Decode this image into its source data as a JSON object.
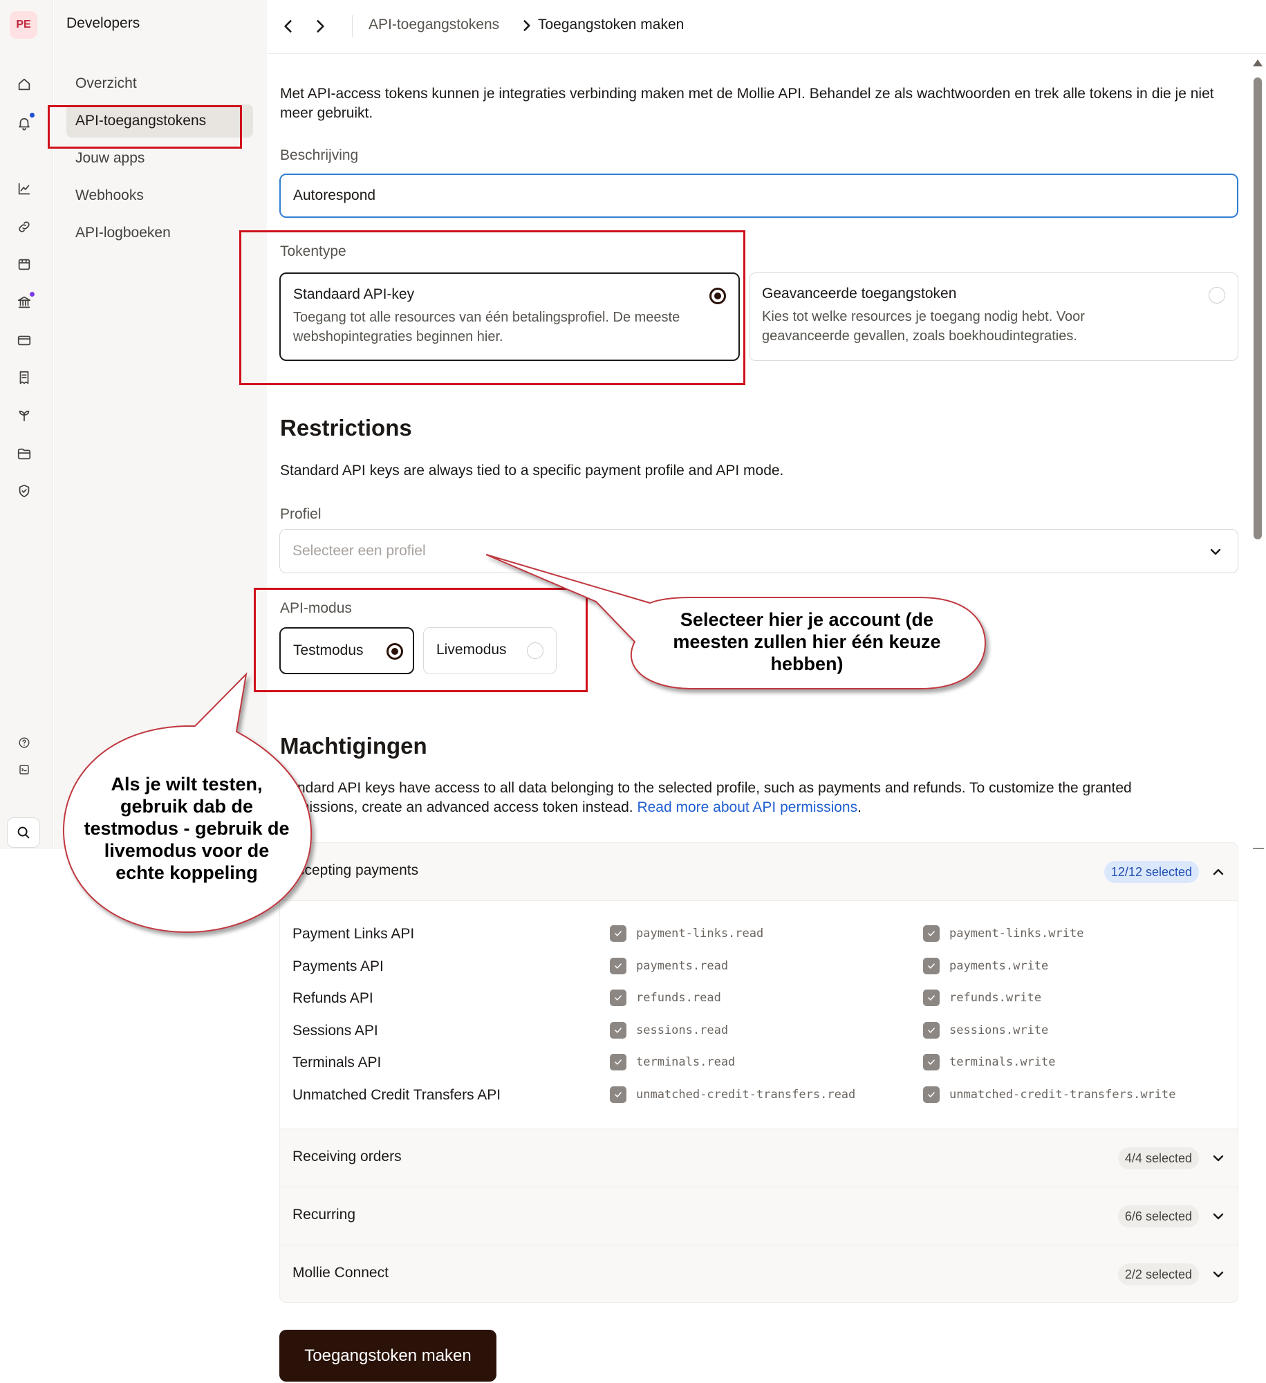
{
  "rail": {
    "avatar": "PE",
    "icons": [
      "home-icon",
      "bell-icon",
      "chart-icon",
      "link-icon",
      "store-icon",
      "bank-icon",
      "card-icon",
      "receipt-icon",
      "sprout-icon",
      "folder-icon",
      "shield-icon",
      "help-icon",
      "terminal-icon",
      "search-icon"
    ],
    "dot_colors": {
      "notifications": "#1f4fd1",
      "bank": "#7c3aed"
    }
  },
  "nav": {
    "title": "Developers",
    "items": [
      "Overzicht",
      "API-toegangstokens",
      "Jouw apps",
      "Webhooks",
      "API-logboeken"
    ],
    "active": "API-toegangstokens"
  },
  "breadcrumb": {
    "parent": "API-toegangstokens",
    "current": "Toegangstoken maken"
  },
  "intro": "Met API-access tokens kunnen je integraties verbinding maken met de Mollie API. Behandel ze als wachtwoorden en trek alle tokens in die je niet meer gebruikt.",
  "description": {
    "label": "Beschrijving",
    "value": "Autorespond"
  },
  "token_type": {
    "label": "Tokentype",
    "options": [
      {
        "title": "Standaard API-key",
        "desc": "Toegang tot alle resources van één betalingsprofiel. De meeste webshopintegraties beginnen hier.",
        "selected": true
      },
      {
        "title": "Geavanceerde toegangstoken",
        "desc": "Kies tot welke resources je toegang nodig hebt. Voor geavanceerde gevallen, zoals boekhoudintegraties.",
        "selected": false
      }
    ]
  },
  "restrictions": {
    "heading": "Restrictions",
    "text": "Standard API keys are always tied to a specific payment profile and API mode.",
    "profile_label": "Profiel",
    "profile_placeholder": "Selecteer een profiel",
    "mode_label": "API-modus",
    "modes": [
      {
        "label": "Testmodus",
        "selected": true
      },
      {
        "label": "Livemodus",
        "selected": false
      }
    ]
  },
  "permissions": {
    "heading": "Machtigingen",
    "text_visible": "ndard API keys have access to all data belonging to the selected profile, such as payments and refunds. To customize the granted",
    "text_line2": "missions, create an advanced access token instead.",
    "link": "Read more about API permissions",
    "link_suffix": ".",
    "groups": [
      {
        "title": "ccepting payments",
        "badge": "12/12 selected",
        "expanded": true,
        "rows": [
          {
            "api": "Payment Links API",
            "read": "payment-links.read",
            "write": "payment-links.write"
          },
          {
            "api": "Payments API",
            "read": "payments.read",
            "write": "payments.write"
          },
          {
            "api": "Refunds API",
            "read": "refunds.read",
            "write": "refunds.write"
          },
          {
            "api": "Sessions API",
            "read": "sessions.read",
            "write": "sessions.write"
          },
          {
            "api": "Terminals API",
            "read": "terminals.read",
            "write": "terminals.write"
          },
          {
            "api": "Unmatched Credit Transfers API",
            "read": "unmatched-credit-transfers.read",
            "write": "unmatched-credit-transfers.write"
          }
        ]
      },
      {
        "title": "Receiving orders",
        "badge": "4/4 selected",
        "expanded": false
      },
      {
        "title": "Recurring",
        "badge": "6/6 selected",
        "expanded": false
      },
      {
        "title": "Mollie Connect",
        "badge": "2/2 selected",
        "expanded": false
      }
    ]
  },
  "submit": "Toegangstoken maken",
  "annotations": {
    "callout_profile": "Selecteer hier je account (de meesten zullen hier één keuze hebben)",
    "callout_mode": "Als je wilt testen, gebruik dab de testmodus - gebruik de livemodus voor de echte koppeling",
    "highlight_color": "#d0111b"
  }
}
